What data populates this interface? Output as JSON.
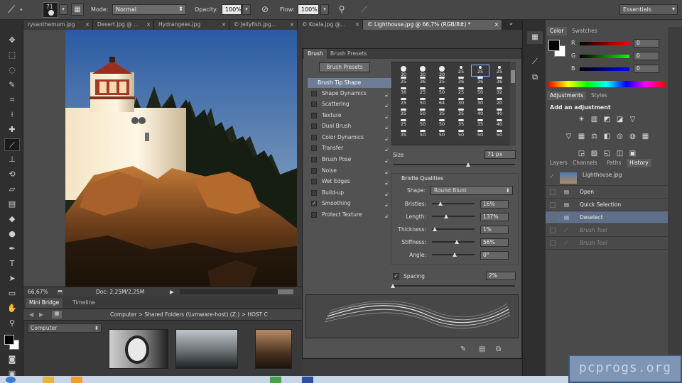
{
  "options_bar": {
    "brush_size": "71",
    "mode_label": "Mode:",
    "mode_value": "Normal",
    "opacity_label": "Opacity:",
    "opacity_value": "100%",
    "flow_label": "Flow:",
    "flow_value": "100%",
    "workspace": "Essentials"
  },
  "document_tabs": [
    {
      "label": "rysanthemum.jpg"
    },
    {
      "label": "Desert.jpg @ ..."
    },
    {
      "label": "Hydrangeas.jpg"
    },
    {
      "label": "© Jellyfish.jpg..."
    },
    {
      "label": "© Koala.jpg @..."
    },
    {
      "label": "© Lighthouse.jpg @ 66,7% (RGB/8#) *"
    }
  ],
  "doc_status": {
    "zoom": "66,67%",
    "doc_size": "Doc: 2,25M/2,25M"
  },
  "mini_bridge": {
    "tab_bridge": "Mini Bridge",
    "tab_timeline": "Timeline",
    "path": "Computer > Shared Folders (\\\\vmware-host) (Z:) > HOST C",
    "location": "Computer"
  },
  "brush_panel": {
    "tab_brush": "Brush",
    "tab_presets": "Brush Presets",
    "presets_button": "Brush Presets",
    "items": [
      {
        "label": "Brush Tip Shape",
        "checked": false,
        "selected": true
      },
      {
        "label": "Shape Dynamics",
        "checked": false
      },
      {
        "label": "Scattering",
        "checked": false
      },
      {
        "label": "Texture",
        "checked": false
      },
      {
        "label": "Dual Brush",
        "checked": false
      },
      {
        "label": "Color Dynamics",
        "checked": false
      },
      {
        "label": "Transfer",
        "checked": false
      },
      {
        "label": "Brush Pose",
        "checked": false
      },
      {
        "label": "Noise",
        "checked": false
      },
      {
        "label": "Wet Edges",
        "checked": false
      },
      {
        "label": "Build-up",
        "checked": false
      },
      {
        "label": "Smoothing",
        "checked": true
      },
      {
        "label": "Protect Texture",
        "checked": false
      }
    ],
    "tip_sizes": [
      [
        "30",
        "30",
        "30",
        "25",
        "25",
        "25"
      ],
      [
        "25",
        "36",
        "25",
        "36",
        "36",
        "36"
      ],
      [
        "36",
        "25",
        "50",
        "25",
        "50",
        "32"
      ],
      [
        "25",
        "50",
        "64",
        "30",
        "30",
        "20"
      ],
      [
        "25",
        "50",
        "35",
        "35",
        "40",
        "40"
      ],
      [
        "25",
        "50",
        "50",
        "35",
        "35",
        "40"
      ],
      [
        "35",
        "50",
        "50",
        "50",
        "50",
        "50"
      ]
    ],
    "size_label": "Size",
    "size_value": "71 px",
    "bristle_title": "Bristle Qualities",
    "shape_label": "Shape:",
    "shape_value": "Round Blunt",
    "params": [
      {
        "label": "Bristles:",
        "value": "16%",
        "level": 0.16
      },
      {
        "label": "Length:",
        "value": "137%",
        "level": 0.3
      },
      {
        "label": "Thickness:",
        "value": "1%",
        "level": 0.01
      },
      {
        "label": "Stiffness:",
        "value": "56%",
        "level": 0.56
      },
      {
        "label": "Angle:",
        "value": "0°",
        "level": 0.5
      }
    ],
    "spacing_label": "Spacing",
    "spacing_value": "2%"
  },
  "color_panel": {
    "tab_color": "Color",
    "tab_swatches": "Swatches",
    "r_label": "R",
    "r_value": "0",
    "g_label": "G",
    "g_value": "0",
    "b_label": "B",
    "b_value": "0"
  },
  "adjustments_panel": {
    "tab_adjustments": "Adjustments",
    "tab_styles": "Styles",
    "heading": "Add an adjustment"
  },
  "history_panel": {
    "tabs": [
      "Layers",
      "Channels",
      "Paths",
      "History"
    ],
    "snapshot": "Lighthouse.jpg",
    "states": [
      {
        "label": "Open",
        "active": false
      },
      {
        "label": "Quick Selection",
        "active": false
      },
      {
        "label": "Deselect",
        "active": true
      },
      {
        "label": "Brush Tool",
        "active": false,
        "undone": true
      },
      {
        "label": "Brush Tool",
        "active": false,
        "undone": true
      }
    ]
  },
  "watermark": "pcprogs.org"
}
